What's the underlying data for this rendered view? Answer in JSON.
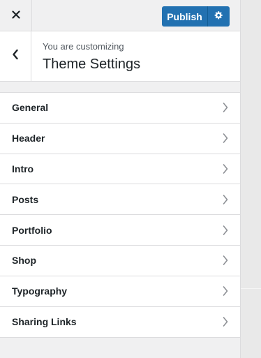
{
  "header": {
    "close_icon": "close-icon",
    "publish_label": "Publish",
    "settings_icon": "gear-icon"
  },
  "info": {
    "subtitle": "You are customizing",
    "title": "Theme Settings",
    "back_icon": "chevron-left-icon"
  },
  "menu": {
    "items": [
      {
        "label": "General"
      },
      {
        "label": "Header"
      },
      {
        "label": "Intro"
      },
      {
        "label": "Posts"
      },
      {
        "label": "Portfolio"
      },
      {
        "label": "Shop"
      },
      {
        "label": "Typography"
      },
      {
        "label": "Sharing Links"
      }
    ],
    "item_icon": "chevron-right-icon"
  },
  "colors": {
    "accent": "#2271b1",
    "panel_bg": "#f0f0f1",
    "border": "#dcdcde",
    "text": "#1d2327"
  }
}
